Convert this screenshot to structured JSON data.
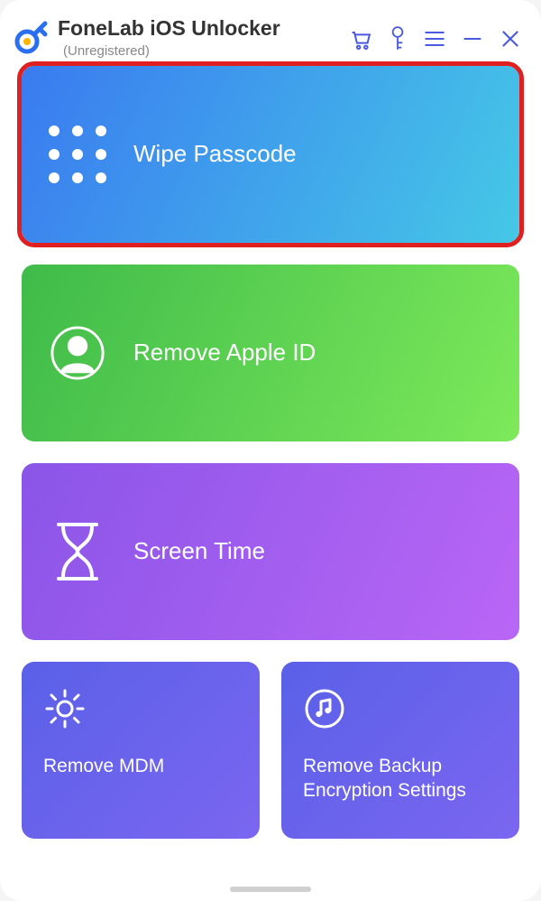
{
  "header": {
    "title": "FoneLab iOS Unlocker",
    "subtitle": "(Unregistered)"
  },
  "cards": {
    "wipe_passcode": "Wipe Passcode",
    "remove_apple_id": "Remove Apple ID",
    "screen_time": "Screen Time",
    "remove_mdm": "Remove MDM",
    "remove_backup_enc": "Remove Backup Encryption Settings"
  }
}
